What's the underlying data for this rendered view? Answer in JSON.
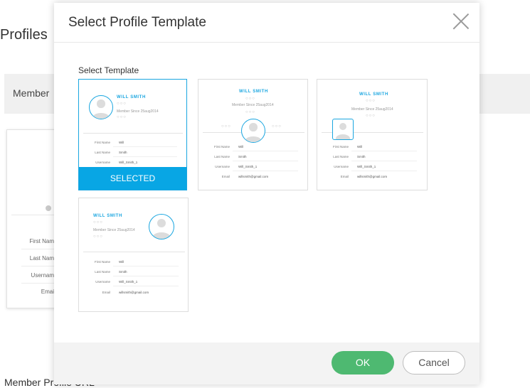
{
  "background": {
    "page_title": "Profiles",
    "band_label": "Member",
    "card_fields": [
      "First Nam",
      "Last Nam",
      "Usernam",
      "Emai"
    ],
    "bottom_label": "Member Profile URL"
  },
  "modal": {
    "title": "Select Profile Template",
    "section_label": "Select Template",
    "selected_label": "SELECTED",
    "ok_label": "OK",
    "cancel_label": "Cancel",
    "templates": [
      {
        "name": "WILL SMITH",
        "since": "Member Since 25aug2014",
        "dots": "○○○",
        "fields": [
          {
            "label": "First Name",
            "value": "Will"
          },
          {
            "label": "Last Name",
            "value": "Smith"
          },
          {
            "label": "Username",
            "value": "Will_Smith_1"
          }
        ],
        "selected": true
      },
      {
        "name": "WILL SMITH",
        "since": "Member Since 25aug2014",
        "dots": "○○○",
        "side_dots": "○○○",
        "fields": [
          {
            "label": "First Name",
            "value": "Will"
          },
          {
            "label": "Last Name",
            "value": "Smith"
          },
          {
            "label": "Username",
            "value": "Will_Smith_1"
          },
          {
            "label": "Email",
            "value": "willsmith@gmail.com"
          }
        ],
        "selected": false
      },
      {
        "name": "WILL SMITH",
        "since": "Member Since 25aug2014",
        "dots": "○○○",
        "fields": [
          {
            "label": "First Name",
            "value": "Will"
          },
          {
            "label": "Last Name",
            "value": "Smith"
          },
          {
            "label": "Username",
            "value": "Will_Smith_1"
          },
          {
            "label": "Email",
            "value": "willsmith@gmail.com"
          }
        ],
        "selected": false
      },
      {
        "name": "WILL SMITH",
        "since": "Member Since 25aug2014",
        "dots": "○○○",
        "fields": [
          {
            "label": "First Name",
            "value": "Will"
          },
          {
            "label": "Last Name",
            "value": "Smith"
          },
          {
            "label": "Username",
            "value": "Will_Smith_1"
          },
          {
            "label": "Email",
            "value": "willsmith@gmail.com"
          }
        ],
        "selected": false
      }
    ]
  },
  "colors": {
    "accent": "#08a6e4",
    "ok": "#4eb971",
    "footer": "#f3f3f3"
  }
}
